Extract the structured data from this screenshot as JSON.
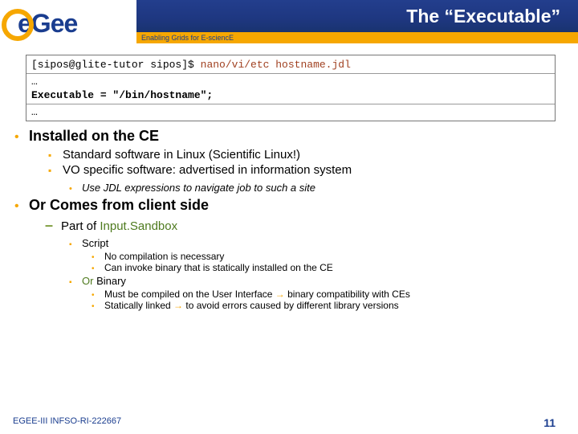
{
  "header": {
    "logo_text": "eGee",
    "title": "The “Executable”",
    "subtitle": "Enabling Grids for E-sciencE"
  },
  "code": {
    "prompt": "[sipos@glite-tutor sipos]$ ",
    "command": "nano/vi/etc hostname.jdl",
    "ellipsis1": "…",
    "line": "Executable = \"/bin/hostname\";",
    "ellipsis2": "…"
  },
  "bullets": {
    "b1": {
      "head": "Installed on the CE",
      "s1": "Standard software in Linux  (Scientific Linux!)",
      "s2": "VO specific software: advertised in information system",
      "s2a": "Use JDL expressions to navigate job to such a site"
    },
    "b2": {
      "head": "Or Comes from client side",
      "d1_a": "Part of ",
      "d1_b": "Input.Sandbox",
      "s1": "Script",
      "s1a": "No compilation is necessary",
      "s1b": "Can invoke binary that is statically installed on the CE",
      "s2_a": "Or ",
      "s2_b": "Binary",
      "s2a_pre": "Must be compiled on the User Interface ",
      "s2a_post": " binary compatibility with CEs",
      "s2b_pre": "Statically linked ",
      "s2b_post": " to avoid errors caused by different library versions"
    }
  },
  "footer": {
    "ref": "EGEE-III INFSO-RI-222667",
    "page": "11"
  }
}
